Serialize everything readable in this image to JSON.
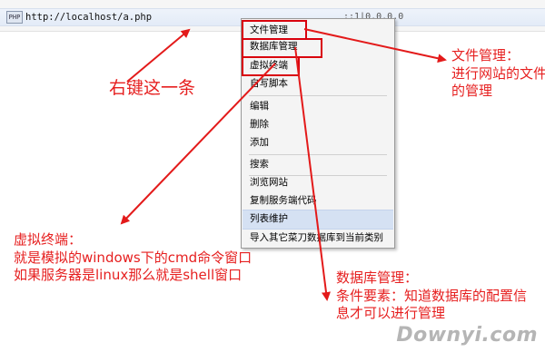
{
  "row": {
    "icon_text": "PHP",
    "url": "http://localhost/a.php",
    "ip": "::1|0.0.0.0"
  },
  "menu": {
    "items": [
      "文件管理",
      "数据库管理",
      "虚拟终端",
      "自写脚本",
      "编辑",
      "删除",
      "添加",
      "搜索",
      "浏览网站",
      "复制服务端代码",
      "列表维护",
      "导入其它菜刀数据库到当前类别"
    ],
    "highlighted_index": 10
  },
  "annotations": {
    "right_click": "右键这一条",
    "file_mgmt": "文件管理：\n进行网站的文件\n的管理",
    "terminal": "虚拟终端：\n就是模拟的windows下的cmd命令窗口\n如果服务器是linux那么就是shell窗口",
    "db_mgmt": "数据库管理：\n条件要素：知道数据库的配置信\n息才可以进行管理"
  },
  "colors": {
    "annotation_red": "#e62020",
    "box_red": "#d9000d",
    "menu_highlight": "#d5e1f3"
  },
  "watermark": "Downyi.com"
}
